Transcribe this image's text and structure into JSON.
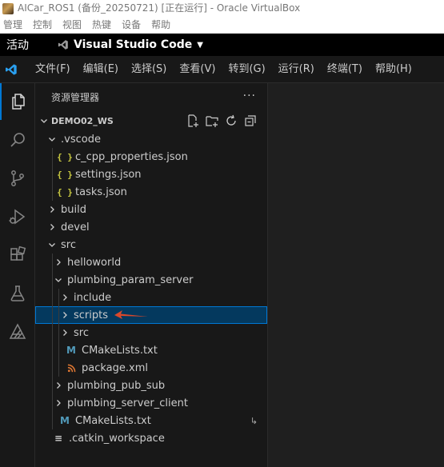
{
  "virtualbox": {
    "title": "AICar_ROS1 (备份_20250721) [正在运行] - Oracle VirtualBox",
    "menu": [
      "管理",
      "控制",
      "视图",
      "热键",
      "设备",
      "帮助"
    ]
  },
  "gnome": {
    "activities": "活动",
    "app_name": "Visual Studio Code"
  },
  "vscode": {
    "menu": [
      "文件(F)",
      "编辑(E)",
      "选择(S)",
      "查看(V)",
      "转到(G)",
      "运行(R)",
      "终端(T)",
      "帮助(H)"
    ],
    "activity_bar": [
      "explorer-icon",
      "search-icon",
      "source-control-icon",
      "run-debug-icon",
      "extensions-icon",
      "testing-icon",
      "ros-icon"
    ],
    "explorer": {
      "title": "资源管理器",
      "more": "···",
      "workspace": "DEMO02_WS",
      "tree": [
        {
          "label": ".vscode",
          "depth": 1,
          "kind": "folder",
          "expanded": true
        },
        {
          "label": "c_cpp_properties.json",
          "depth": 2,
          "kind": "json"
        },
        {
          "label": "settings.json",
          "depth": 2,
          "kind": "json"
        },
        {
          "label": "tasks.json",
          "depth": 2,
          "kind": "json"
        },
        {
          "label": "build",
          "depth": 1,
          "kind": "folder",
          "expanded": false
        },
        {
          "label": "devel",
          "depth": 1,
          "kind": "folder",
          "expanded": false
        },
        {
          "label": "src",
          "depth": 1,
          "kind": "folder",
          "expanded": true
        },
        {
          "label": "helloworld",
          "depth": 2,
          "kind": "folder",
          "expanded": false
        },
        {
          "label": "plumbing_param_server",
          "depth": 2,
          "kind": "folder",
          "expanded": true
        },
        {
          "label": "include",
          "depth": 3,
          "kind": "folder",
          "expanded": false
        },
        {
          "label": "scripts",
          "depth": 3,
          "kind": "folder",
          "expanded": false,
          "selected": true
        },
        {
          "label": "src",
          "depth": 3,
          "kind": "folder",
          "expanded": false
        },
        {
          "label": "CMakeLists.txt",
          "depth": 3,
          "kind": "cmake"
        },
        {
          "label": "package.xml",
          "depth": 3,
          "kind": "xml"
        },
        {
          "label": "plumbing_pub_sub",
          "depth": 2,
          "kind": "folder",
          "expanded": false
        },
        {
          "label": "plumbing_server_client",
          "depth": 2,
          "kind": "folder",
          "expanded": false
        },
        {
          "label": "CMakeLists.txt",
          "depth": 2,
          "kind": "cmake",
          "symlink": true
        },
        {
          "label": ".catkin_workspace",
          "depth": 1,
          "kind": "dotfile"
        }
      ]
    }
  },
  "colors": {
    "accent": "#0078d4",
    "selection": "#04395e",
    "json": "#cbcb41",
    "cmake": "#519aba",
    "xml": "#e37933",
    "annotation_arrow": "#d9482b"
  }
}
